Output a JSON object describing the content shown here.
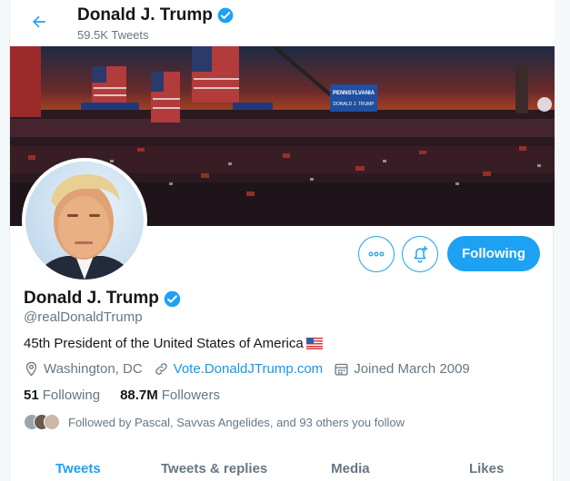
{
  "header": {
    "name": "Donald J. Trump",
    "tweet_count": "59.5K Tweets"
  },
  "banner": {
    "signs": [
      "PENNSYLVANIA",
      "DONALD J. TRUMP"
    ]
  },
  "actions": {
    "follow_label": "Following"
  },
  "profile": {
    "name": "Donald J. Trump",
    "handle": "@realDonaldTrump",
    "bio": "45th President of the United States of America",
    "location": "Washington, DC",
    "website": "Vote.DonaldJTrump.com",
    "joined": "Joined March 2009",
    "following_count": "51",
    "following_label": "Following",
    "followers_count": "88.7M",
    "followers_label": "Followers",
    "followed_by": "Followed by Pascal, Savvas Angelides, and 93 others you follow"
  },
  "tabs": [
    "Tweets",
    "Tweets & replies",
    "Media",
    "Likes"
  ],
  "colors": {
    "accent": "#1da1f2",
    "link": "#1b95e0",
    "muted": "#657786",
    "text": "#14171a"
  }
}
